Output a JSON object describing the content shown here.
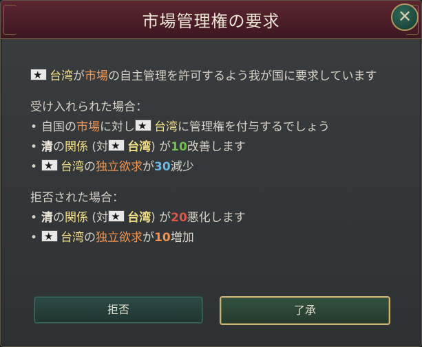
{
  "dialog": {
    "title": "市場管理権の要求",
    "close_label": "✕"
  },
  "intro": {
    "country": "台湾",
    "t1": "が",
    "market": "市場",
    "t2": "の自主管理を許可するよう我が国に要求しています"
  },
  "accept_section": {
    "heading": "受け入れられた場合：",
    "b1": {
      "t1": "自国の",
      "market": "市場",
      "t2": "に対し",
      "country": "台湾",
      "t3": "に管理権を付与するでしょう"
    },
    "b2": {
      "nation": "清",
      "t1": "の",
      "relations": "関係",
      "t2": " (対",
      "country": "台湾",
      "t3": ") が",
      "value": "10",
      "t4": "改善します"
    },
    "b3": {
      "country": "台湾",
      "t1": "の",
      "independence": "独立欲求",
      "t2": "が",
      "value": "30",
      "t3": "減少"
    }
  },
  "reject_section": {
    "heading": "拒否された場合：",
    "b1": {
      "nation": "清",
      "t1": "の",
      "relations": "関係",
      "t2": " (対",
      "country": "台湾",
      "t3": ") が",
      "value": "20",
      "t4": "悪化します"
    },
    "b2": {
      "country": "台湾",
      "t1": "の",
      "independence": "独立欲求",
      "t2": "が",
      "value": "10",
      "t3": "増加"
    }
  },
  "buttons": {
    "reject": "拒否",
    "accept": "了承"
  },
  "colors": {
    "highlight_orange": "#f19451",
    "highlight_yellow": "#f3df84",
    "positive_green": "#70c04e",
    "neutral_blue": "#66b8e6",
    "negative_red": "#e2564a",
    "accept_border_gold": "#c9b472"
  }
}
